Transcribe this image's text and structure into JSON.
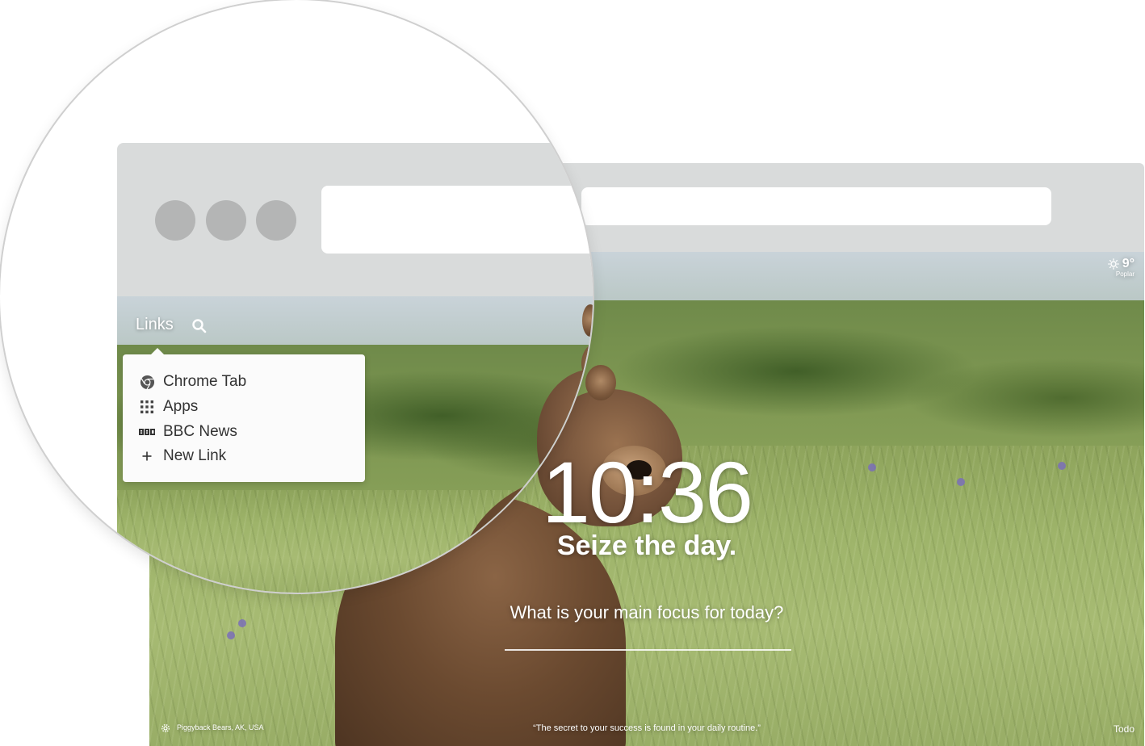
{
  "links_menu": {
    "title": "Links",
    "items": [
      {
        "label": "Chrome Tab",
        "icon": "chrome-icon"
      },
      {
        "label": "Apps",
        "icon": "apps-grid-icon"
      },
      {
        "label": "BBC News",
        "icon": "bbc-icon"
      },
      {
        "label": "New Link",
        "icon": "plus-icon"
      }
    ]
  },
  "dashboard": {
    "time": "10:36",
    "greeting": "Seize the day.",
    "focus_prompt": "What is your main focus for today?",
    "quote": "“The secret to your success is found in your daily routine.”",
    "photo_location": "Piggyback Bears, AK, USA",
    "todo_label": "Todo",
    "weather": {
      "temp": "9°",
      "city": "Poplar",
      "icon": "sun-icon"
    }
  },
  "colors": {
    "chrome_gray": "#d9dbdb",
    "traffic_dot": "#b4b5b5",
    "popup_bg": "#fbfbfb",
    "overlay_text": "#ffffff"
  }
}
